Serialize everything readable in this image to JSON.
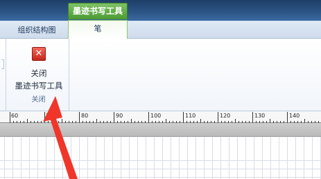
{
  "context_tab_group": {
    "label": "墨迹书写工具"
  },
  "tabs": [
    {
      "label": "组织结构图",
      "active": false
    },
    {
      "label": "笔",
      "active": true
    }
  ],
  "ribbon": {
    "close_group": {
      "button_line1": "关闭",
      "button_line2": "墨迹书写工具",
      "group_label": "关闭",
      "icon": "close-icon"
    }
  },
  "ruler": {
    "labels": [
      "60",
      "70",
      "80",
      "90",
      "100",
      "110",
      "120",
      "130",
      "140"
    ]
  },
  "colors": {
    "title_bar": "#2b5383",
    "context_tab": "#5aa83f",
    "close_icon": "#d8372b",
    "annotation_arrow": "#f0352a"
  }
}
